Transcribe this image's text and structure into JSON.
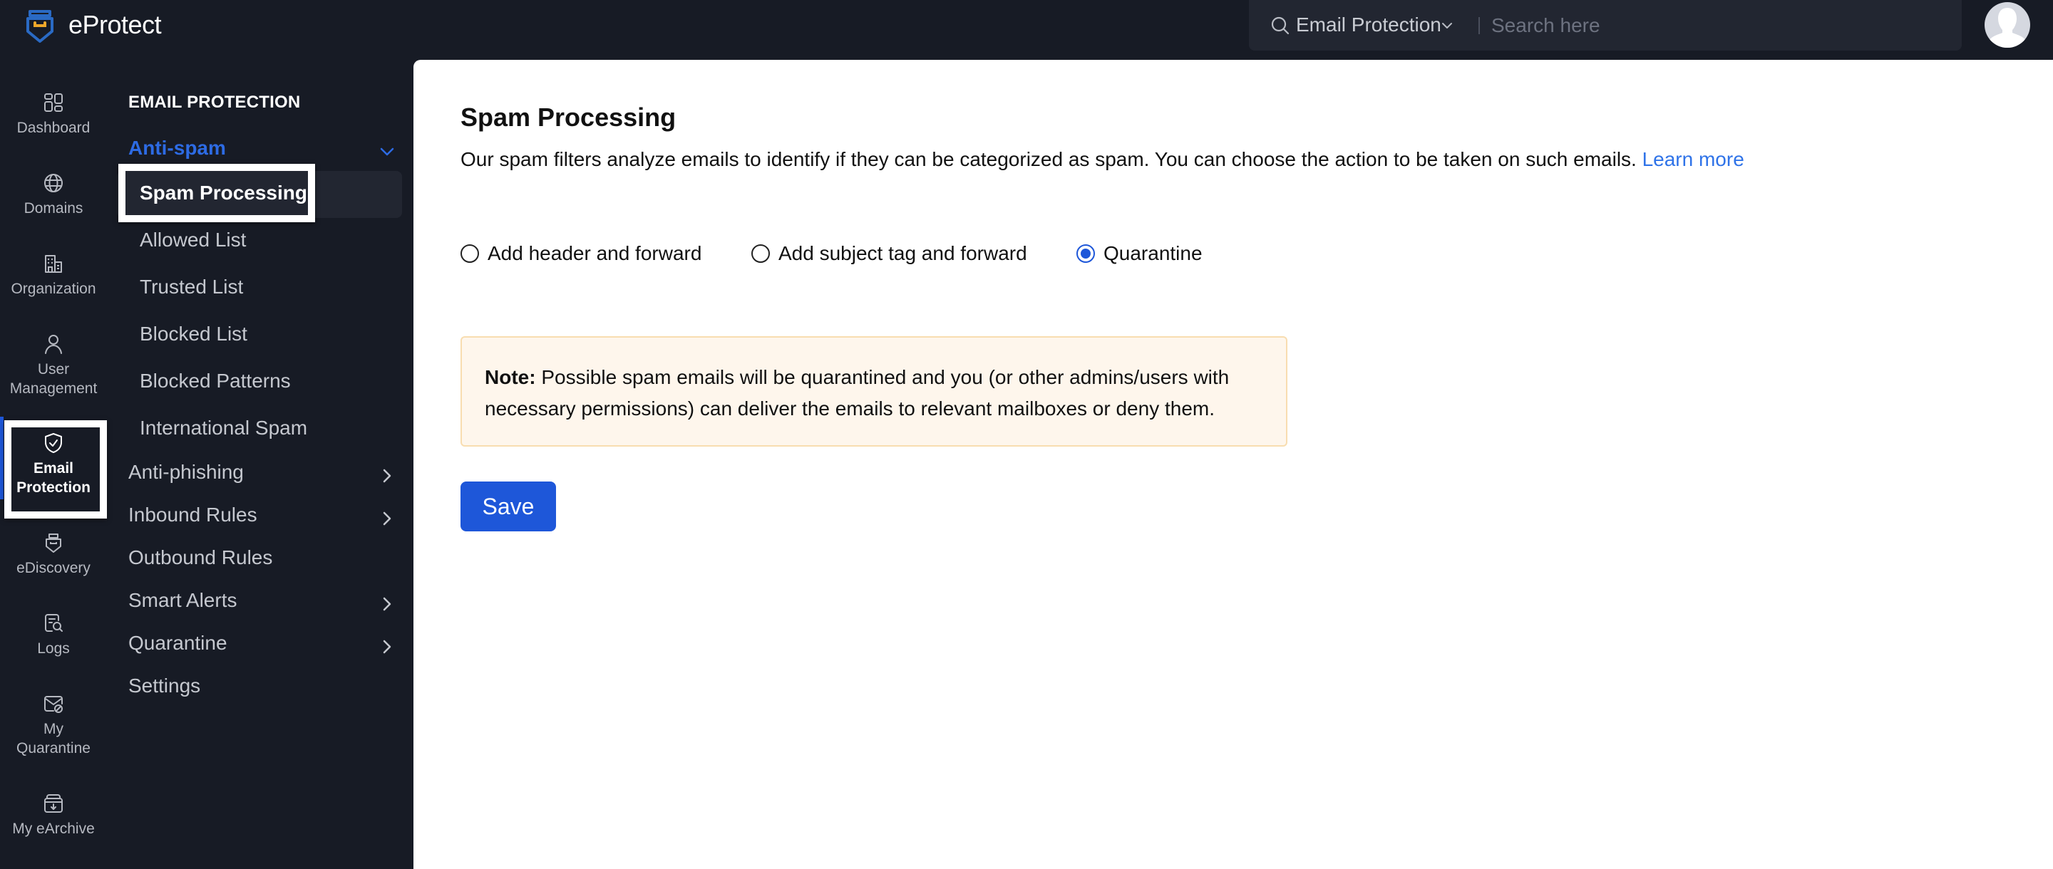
{
  "app": {
    "brand": "eProtect",
    "colors": {
      "accent": "#1e57d9",
      "link": "#2f73e8",
      "sidebar_bg": "#171b25",
      "note_bg": "#fef6ec",
      "note_border": "#f8ddb0"
    }
  },
  "topbar": {
    "search_scope": "Email Protection",
    "search_placeholder": "Search here",
    "search_value": ""
  },
  "rail": {
    "items": [
      {
        "label": "Dashboard",
        "icon": "dashboard-icon"
      },
      {
        "label": "Domains",
        "icon": "globe-icon"
      },
      {
        "label": "Organization",
        "icon": "building-icon"
      },
      {
        "label_line1": "User",
        "label_line2": "Management",
        "icon": "user-icon"
      },
      {
        "label_line1": "Email",
        "label_line2": "Protection",
        "icon": "shield-check-icon",
        "active": true
      },
      {
        "label": "eDiscovery",
        "icon": "ediscovery-icon"
      },
      {
        "label": "Logs",
        "icon": "logs-search-icon"
      },
      {
        "label_line1": "My",
        "label_line2": "Quarantine",
        "icon": "mail-blocked-icon"
      },
      {
        "label": "My eArchive",
        "icon": "archive-icon"
      }
    ]
  },
  "subnav": {
    "heading": "EMAIL PROTECTION",
    "groups": [
      {
        "label": "Anti-spam",
        "expanded": true,
        "children": [
          "Spam Processing",
          "Allowed List",
          "Trusted List",
          "Blocked List",
          "Blocked Patterns",
          "International Spam"
        ],
        "active_child": "Spam Processing"
      },
      {
        "label": "Anti-phishing",
        "has_children": true
      },
      {
        "label": "Inbound Rules",
        "has_children": true
      },
      {
        "label": "Outbound Rules",
        "has_children": false
      },
      {
        "label": "Smart Alerts",
        "has_children": true
      },
      {
        "label": "Quarantine",
        "has_children": true
      },
      {
        "label": "Settings",
        "has_children": false
      }
    ]
  },
  "main": {
    "title": "Spam Processing",
    "description": "Our spam filters analyze emails to identify if they can be categorized as spam. You can choose the action to be taken on such emails.",
    "learn_more": "Learn more",
    "options": [
      {
        "label": "Add header and forward",
        "selected": false
      },
      {
        "label": "Add subject tag and forward",
        "selected": false
      },
      {
        "label": "Quarantine",
        "selected": true
      }
    ],
    "note_label": "Note:",
    "note_line1": "Possible spam emails will be quarantined and you (or other admins/users with",
    "note_line2": "necessary permissions) can deliver the emails to relevant mailboxes or deny them.",
    "save_label": "Save"
  }
}
